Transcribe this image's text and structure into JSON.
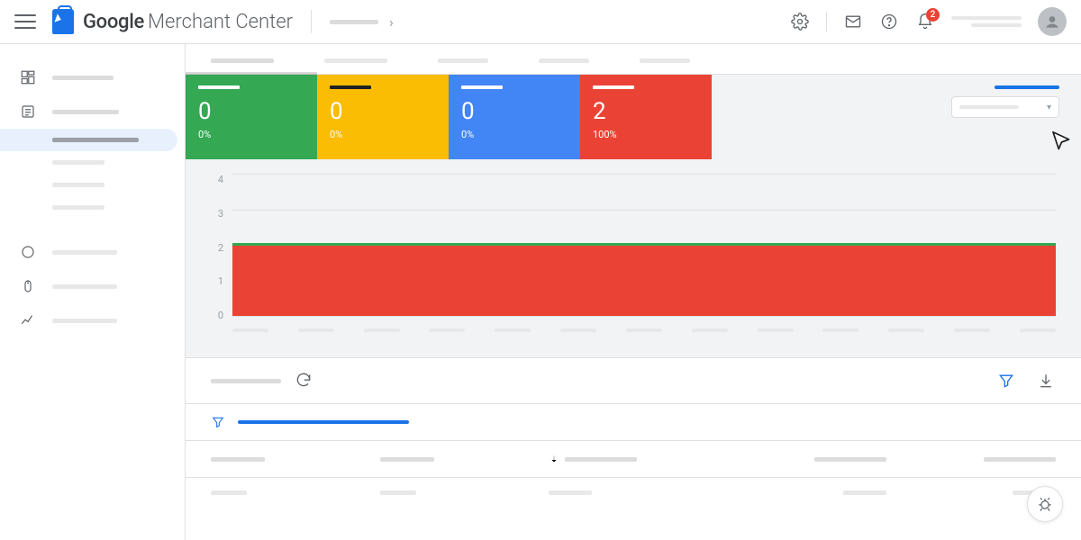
{
  "brand": {
    "google": "Google",
    "product": "Merchant Center"
  },
  "notifications": {
    "count": "2"
  },
  "cards": [
    {
      "value": "0",
      "pct": "0%",
      "color": "c-green"
    },
    {
      "value": "0",
      "pct": "0%",
      "color": "c-amber"
    },
    {
      "value": "0",
      "pct": "0%",
      "color": "c-blue"
    },
    {
      "value": "2",
      "pct": "100%",
      "color": "c-red"
    }
  ],
  "chart_data": {
    "type": "area",
    "ylabel": "",
    "ylim": [
      0,
      4
    ],
    "yticks": [
      "4",
      "3",
      "2",
      "1",
      "0"
    ],
    "x_count": 13,
    "series": [
      {
        "name": "red",
        "constant": 2,
        "style": "fill",
        "color": "#ea4335"
      },
      {
        "name": "green",
        "constant": 2,
        "style": "line",
        "color": "#34a853"
      }
    ]
  },
  "table": {
    "sort_col_index": 2
  }
}
